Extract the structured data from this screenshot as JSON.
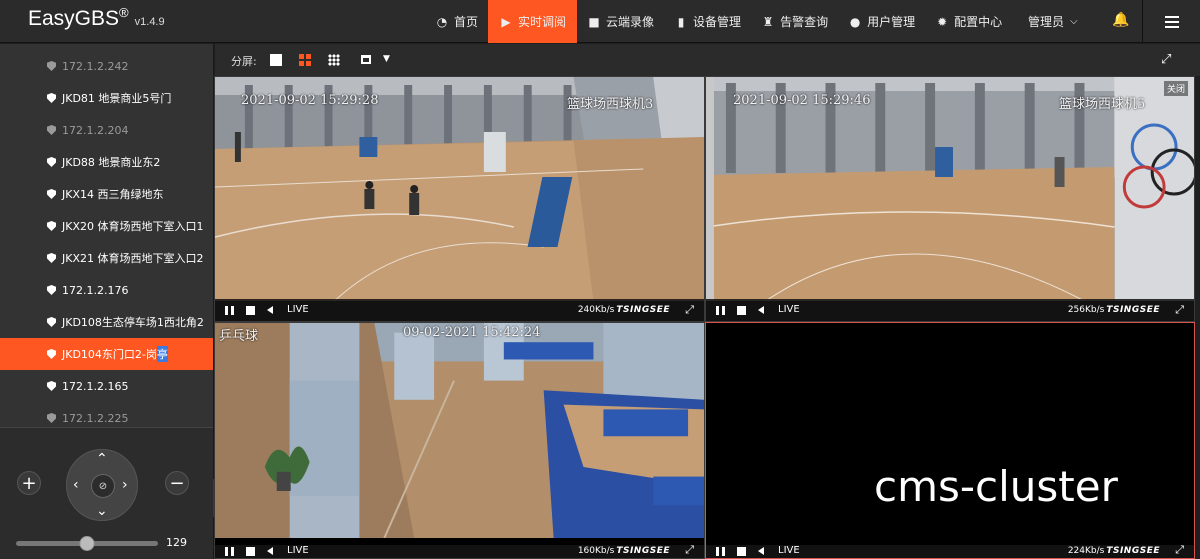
{
  "header": {
    "brand": "EasyGBS",
    "brand_mark": "®",
    "version": "v1.4.9",
    "nav": [
      {
        "label": "首页",
        "icon": "dashboard-icon",
        "glyph": "◔",
        "active": false
      },
      {
        "label": "实时调阅",
        "icon": "play-circle-icon",
        "glyph": "▶",
        "active": true
      },
      {
        "label": "云端录像",
        "icon": "video-camera-icon",
        "glyph": "■",
        "active": false
      },
      {
        "label": "设备管理",
        "icon": "device-icon",
        "glyph": "▮",
        "active": false
      },
      {
        "label": "告警查询",
        "icon": "alarm-icon",
        "glyph": "♜",
        "active": false
      },
      {
        "label": "用户管理",
        "icon": "user-icon",
        "glyph": "●",
        "active": false
      },
      {
        "label": "配置中心",
        "icon": "gear-icon",
        "glyph": "✹",
        "active": false
      }
    ],
    "user": "管理员",
    "user_caret": "⌵",
    "bell": "🔔"
  },
  "sidebar": {
    "devices": [
      {
        "label": "172.1.2.242",
        "status": "offline"
      },
      {
        "label": "JKD81 地景商业5号门",
        "status": "online"
      },
      {
        "label": "172.1.2.204",
        "status": "offline"
      },
      {
        "label": "JKD88 地景商业东2",
        "status": "online"
      },
      {
        "label": "JKX14 西三角绿地东",
        "status": "online"
      },
      {
        "label": "JKX20 体育场西地下室入口1",
        "status": "online"
      },
      {
        "label": "JKX21 体育场西地下室入口2",
        "status": "online"
      },
      {
        "label": "172.1.2.176",
        "status": "online"
      },
      {
        "label": "JKD108生态停车场1西北角2",
        "status": "online"
      },
      {
        "label": "JKD104东门口2-岗",
        "label_highlight": "亭",
        "status": "active"
      },
      {
        "label": "172.1.2.165",
        "status": "online"
      },
      {
        "label": "172.1.2.225",
        "status": "offline"
      }
    ],
    "ptz": {
      "zoom_in": "+",
      "zoom_out": "−",
      "up": "⌃",
      "down": "⌄",
      "left": "‹",
      "right": "›",
      "center": "⊘",
      "speed_value": "129",
      "speed_fraction": 0.5
    },
    "collapse": "‹"
  },
  "toolbar": {
    "split_label": "分屏:",
    "more_caret": "▼",
    "fullscreen": "⤢"
  },
  "players": [
    {
      "time": "2021-09-02  15:29:28",
      "name": "篮球场西球机3",
      "close": "",
      "live": "LIVE",
      "rate": "240Kb/s",
      "brand": "TSINGSEE",
      "pause_glyph": "",
      "expand": "⤢"
    },
    {
      "time": "2021-09-02  15:29:46",
      "name": "篮球场西球机5",
      "close": "关闭",
      "live": "LIVE",
      "rate": "256Kb/s",
      "brand": "TSINGSEE",
      "expand": "⤢"
    },
    {
      "time": "09-02-2021  15:42:24",
      "name": "乒乓球",
      "close": "",
      "live": "LIVE",
      "rate": "160Kb/s",
      "brand": "TSINGSEE",
      "expand": "⤢"
    },
    {
      "time": "",
      "name": "",
      "close": "",
      "live": "LIVE",
      "rate": "224Kb/s",
      "brand": "TSINGSEE",
      "expand": "⤢"
    }
  ],
  "watermark": "cms-cluster",
  "colors": {
    "accent": "#ff5722",
    "header": "#2b2b2b",
    "sidebar": "#333333"
  }
}
